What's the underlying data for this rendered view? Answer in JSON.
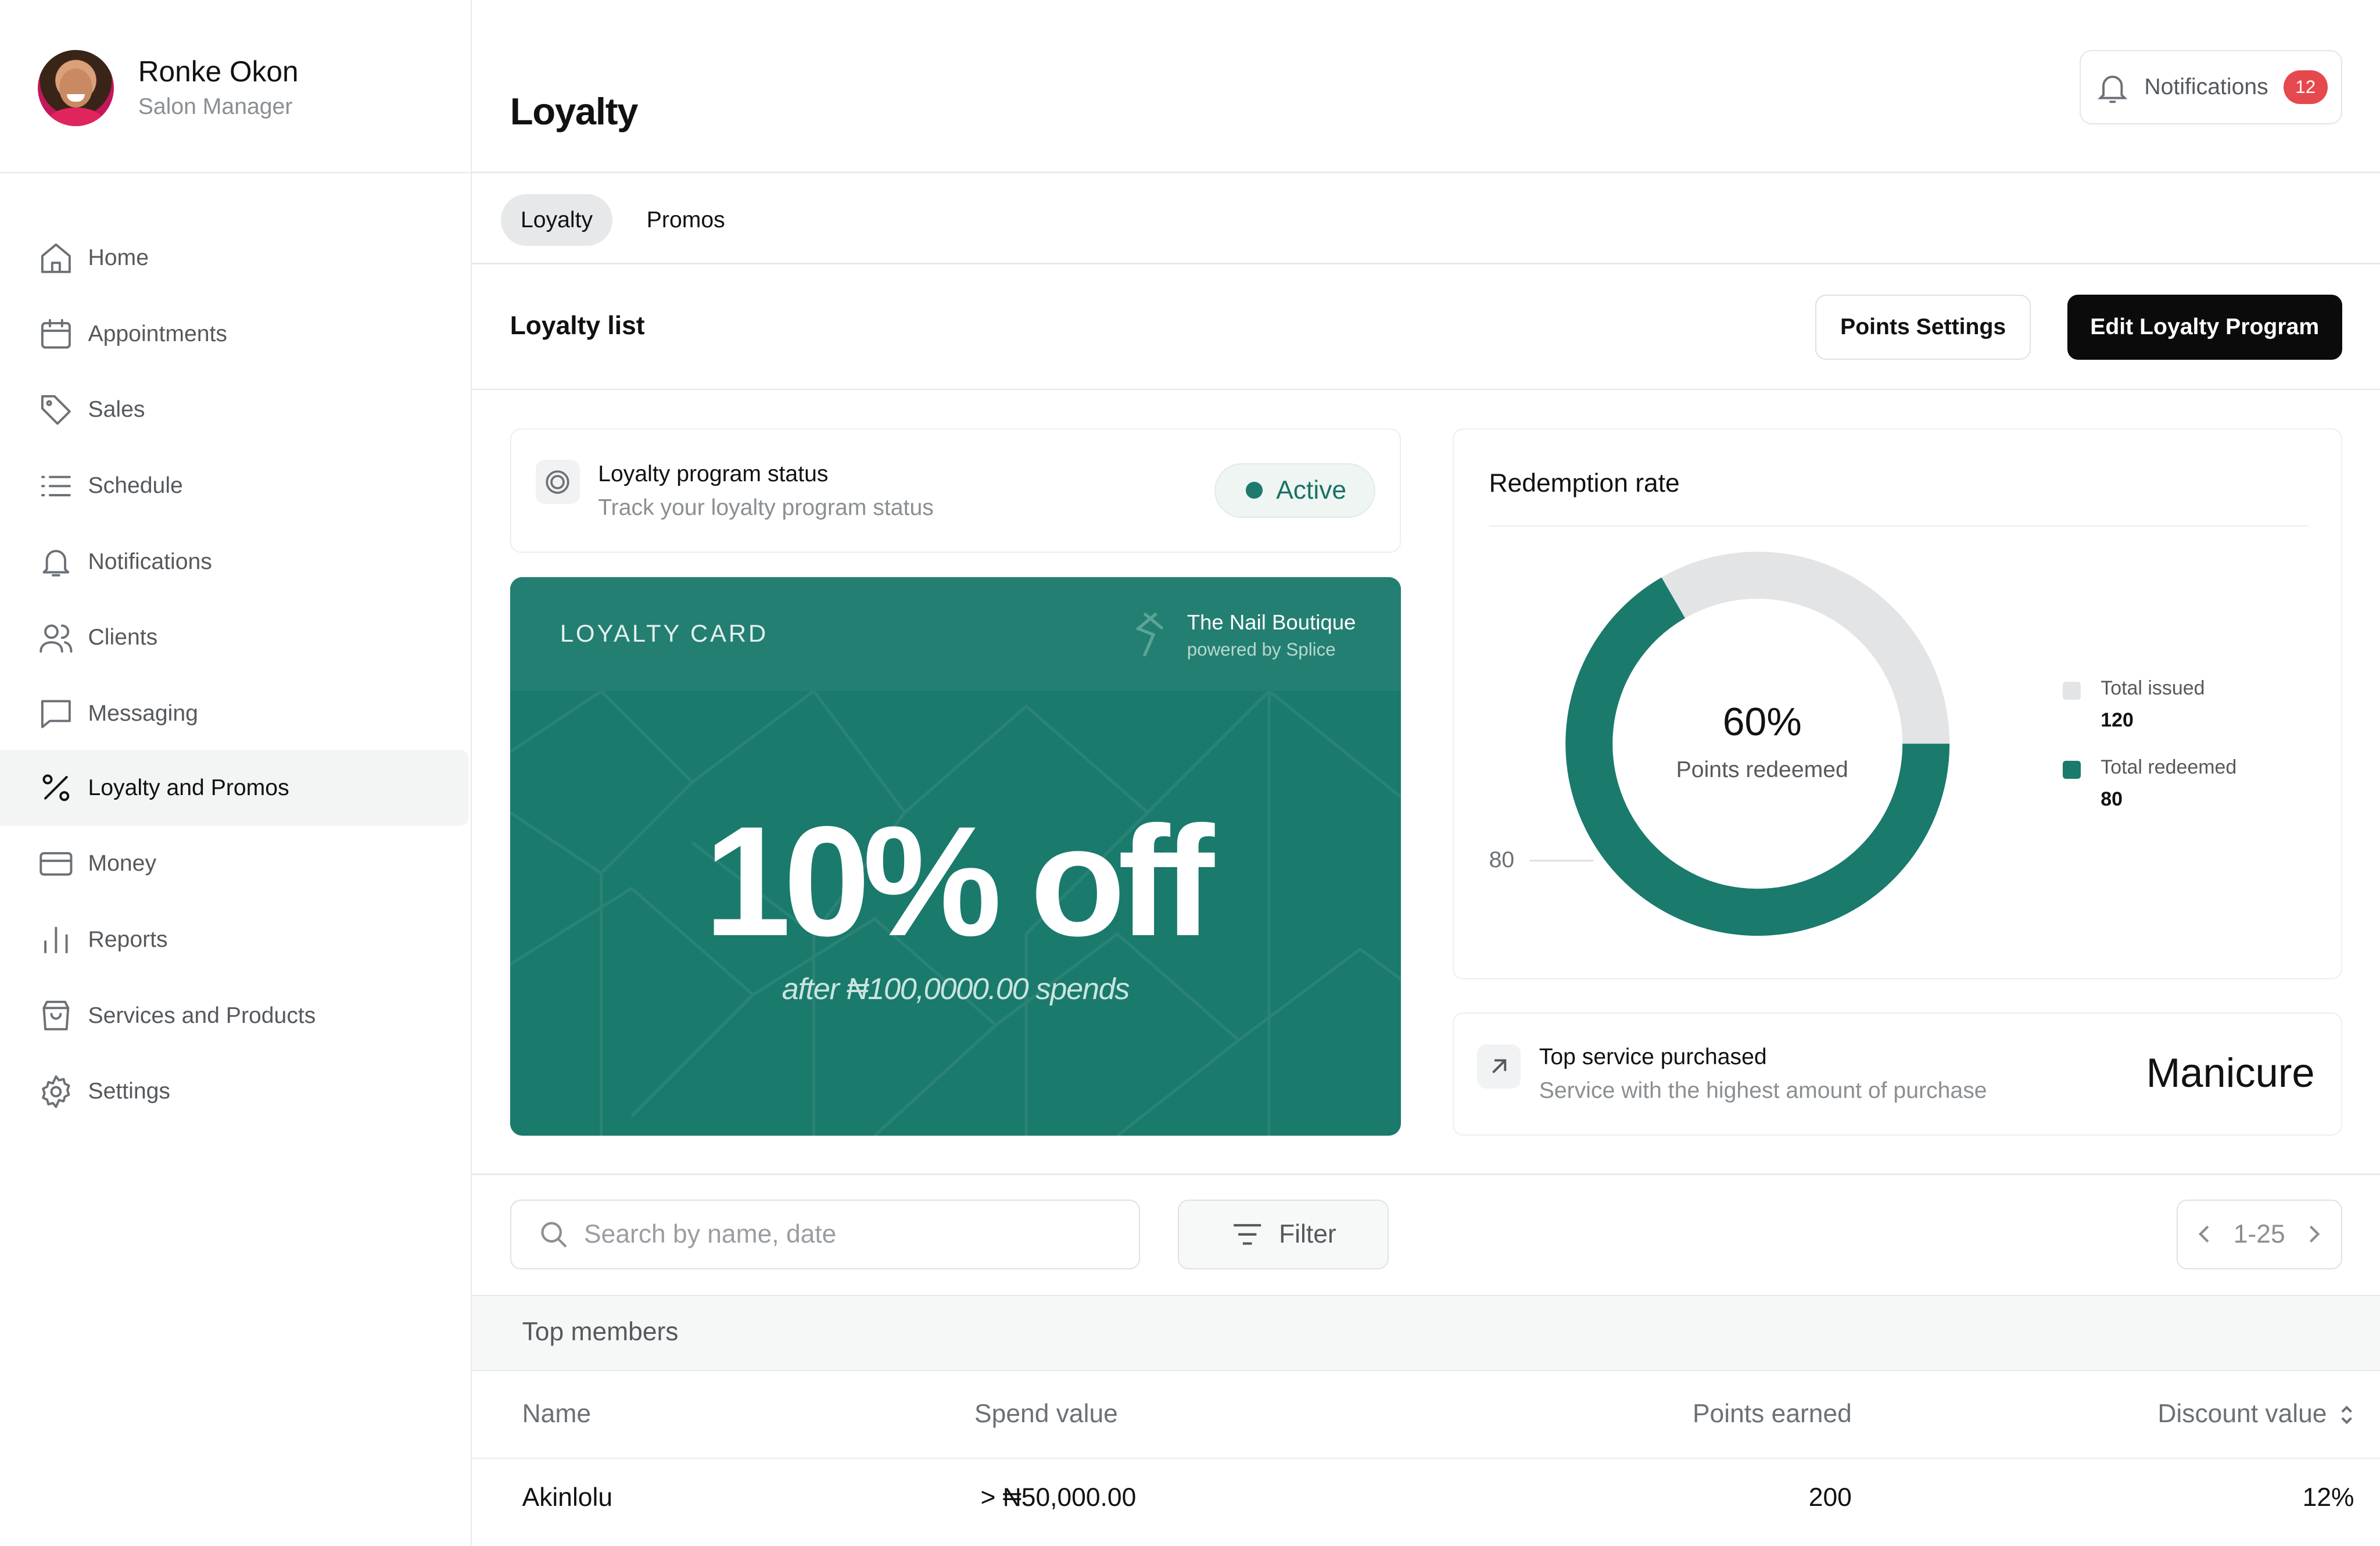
{
  "user": {
    "name": "Ronke Okon",
    "role": "Salon Manager"
  },
  "sidebar": {
    "items": [
      {
        "label": "Home",
        "icon": "home-icon"
      },
      {
        "label": "Appointments",
        "icon": "calendar-icon"
      },
      {
        "label": "Sales",
        "icon": "tag-icon"
      },
      {
        "label": "Schedule",
        "icon": "list-icon"
      },
      {
        "label": "Notifications",
        "icon": "bell-icon"
      },
      {
        "label": "Clients",
        "icon": "users-icon"
      },
      {
        "label": "Messaging",
        "icon": "message-icon"
      },
      {
        "label": "Loyalty and Promos",
        "icon": "percent-icon",
        "active": true
      },
      {
        "label": "Money",
        "icon": "card-icon"
      },
      {
        "label": "Reports",
        "icon": "bar-chart-icon"
      },
      {
        "label": "Services and Products",
        "icon": "shopping-bag-icon"
      },
      {
        "label": "Settings",
        "icon": "gear-icon"
      }
    ]
  },
  "header": {
    "title": "Loyalty",
    "notifications_label": "Notifications",
    "notifications_count": "12"
  },
  "tabs": [
    {
      "label": "Loyalty",
      "active": true
    },
    {
      "label": "Promos",
      "active": false
    }
  ],
  "section": {
    "title": "Loyalty list",
    "points_settings_label": "Points Settings",
    "edit_program_label": "Edit Loyalty Program"
  },
  "status": {
    "title": "Loyalty program status",
    "subtitle": "Track your loyalty program status",
    "value": "Active"
  },
  "loyalty_card": {
    "label": "LOYALTY CARD",
    "brand": "The Nail Boutique",
    "powered_by": "powered by Splice",
    "offer": "10% off",
    "terms": "after ₦100,0000.00 spends"
  },
  "redemption": {
    "title": "Redemption rate",
    "percent_label": "60%",
    "center_caption": "Points redeemed",
    "axis_label": "80",
    "legend": [
      {
        "name": "Total issued",
        "value": "120"
      },
      {
        "name": "Total redeemed",
        "value": "80"
      }
    ]
  },
  "chart_data": {
    "type": "pie",
    "title": "Redemption rate",
    "series": [
      {
        "name": "Total issued",
        "value": 120,
        "color": "#e3e4e5"
      },
      {
        "name": "Total redeemed",
        "value": 80,
        "color": "#1a7a6c"
      }
    ],
    "center_label": "60%",
    "center_caption": "Points redeemed",
    "legend_position": "right"
  },
  "top_service": {
    "title": "Top service purchased",
    "subtitle": "Service with the highest amount of purchase",
    "value": "Manicure"
  },
  "search": {
    "placeholder": "Search by name, date"
  },
  "filter": {
    "label": "Filter"
  },
  "pagination": {
    "range": "1-25"
  },
  "table": {
    "caption": "Top members",
    "columns": [
      "Name",
      "Spend value",
      "Points earned",
      "Discount value"
    ],
    "rows": [
      {
        "name": "Akinlolu",
        "spend": "> ₦50,000.00",
        "points": "200",
        "discount": "12%"
      }
    ]
  },
  "colors": {
    "accent": "#1a7a6c",
    "badge": "#e5484d",
    "primary_button": "#0b0b0b"
  }
}
